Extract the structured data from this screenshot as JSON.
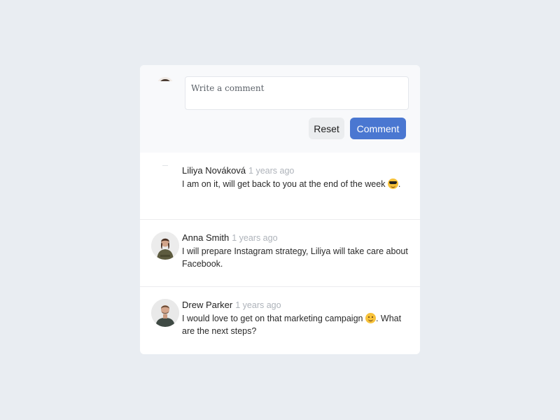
{
  "composer": {
    "placeholder": "Write a comment",
    "reset_label": "Reset",
    "comment_label": "Comment"
  },
  "comments": [
    {
      "author": "Liliya Nováková",
      "time": "1 years ago",
      "text_before": "I am on it, will get back to you at the end of the week ",
      "emoji": "sunglasses-emoji",
      "text_after": "."
    },
    {
      "author": "Anna Smith",
      "time": "1 years ago",
      "text_before": "I will prepare Instagram strategy, Liliya will take care about Facebook.",
      "emoji": "",
      "text_after": ""
    },
    {
      "author": "Drew Parker",
      "time": "1 years ago",
      "text_before": "I would love to get on that marketing campaign ",
      "emoji": "smiling-emoji",
      "text_after": ". What are the next steps?"
    }
  ],
  "colors": {
    "page_background": "#e9edf2",
    "card_background": "#ffffff",
    "composer_background": "#f8f9fb",
    "primary_button": "#4a77d1",
    "secondary_button": "#ebedef",
    "timestamp": "#aeb3ba"
  }
}
